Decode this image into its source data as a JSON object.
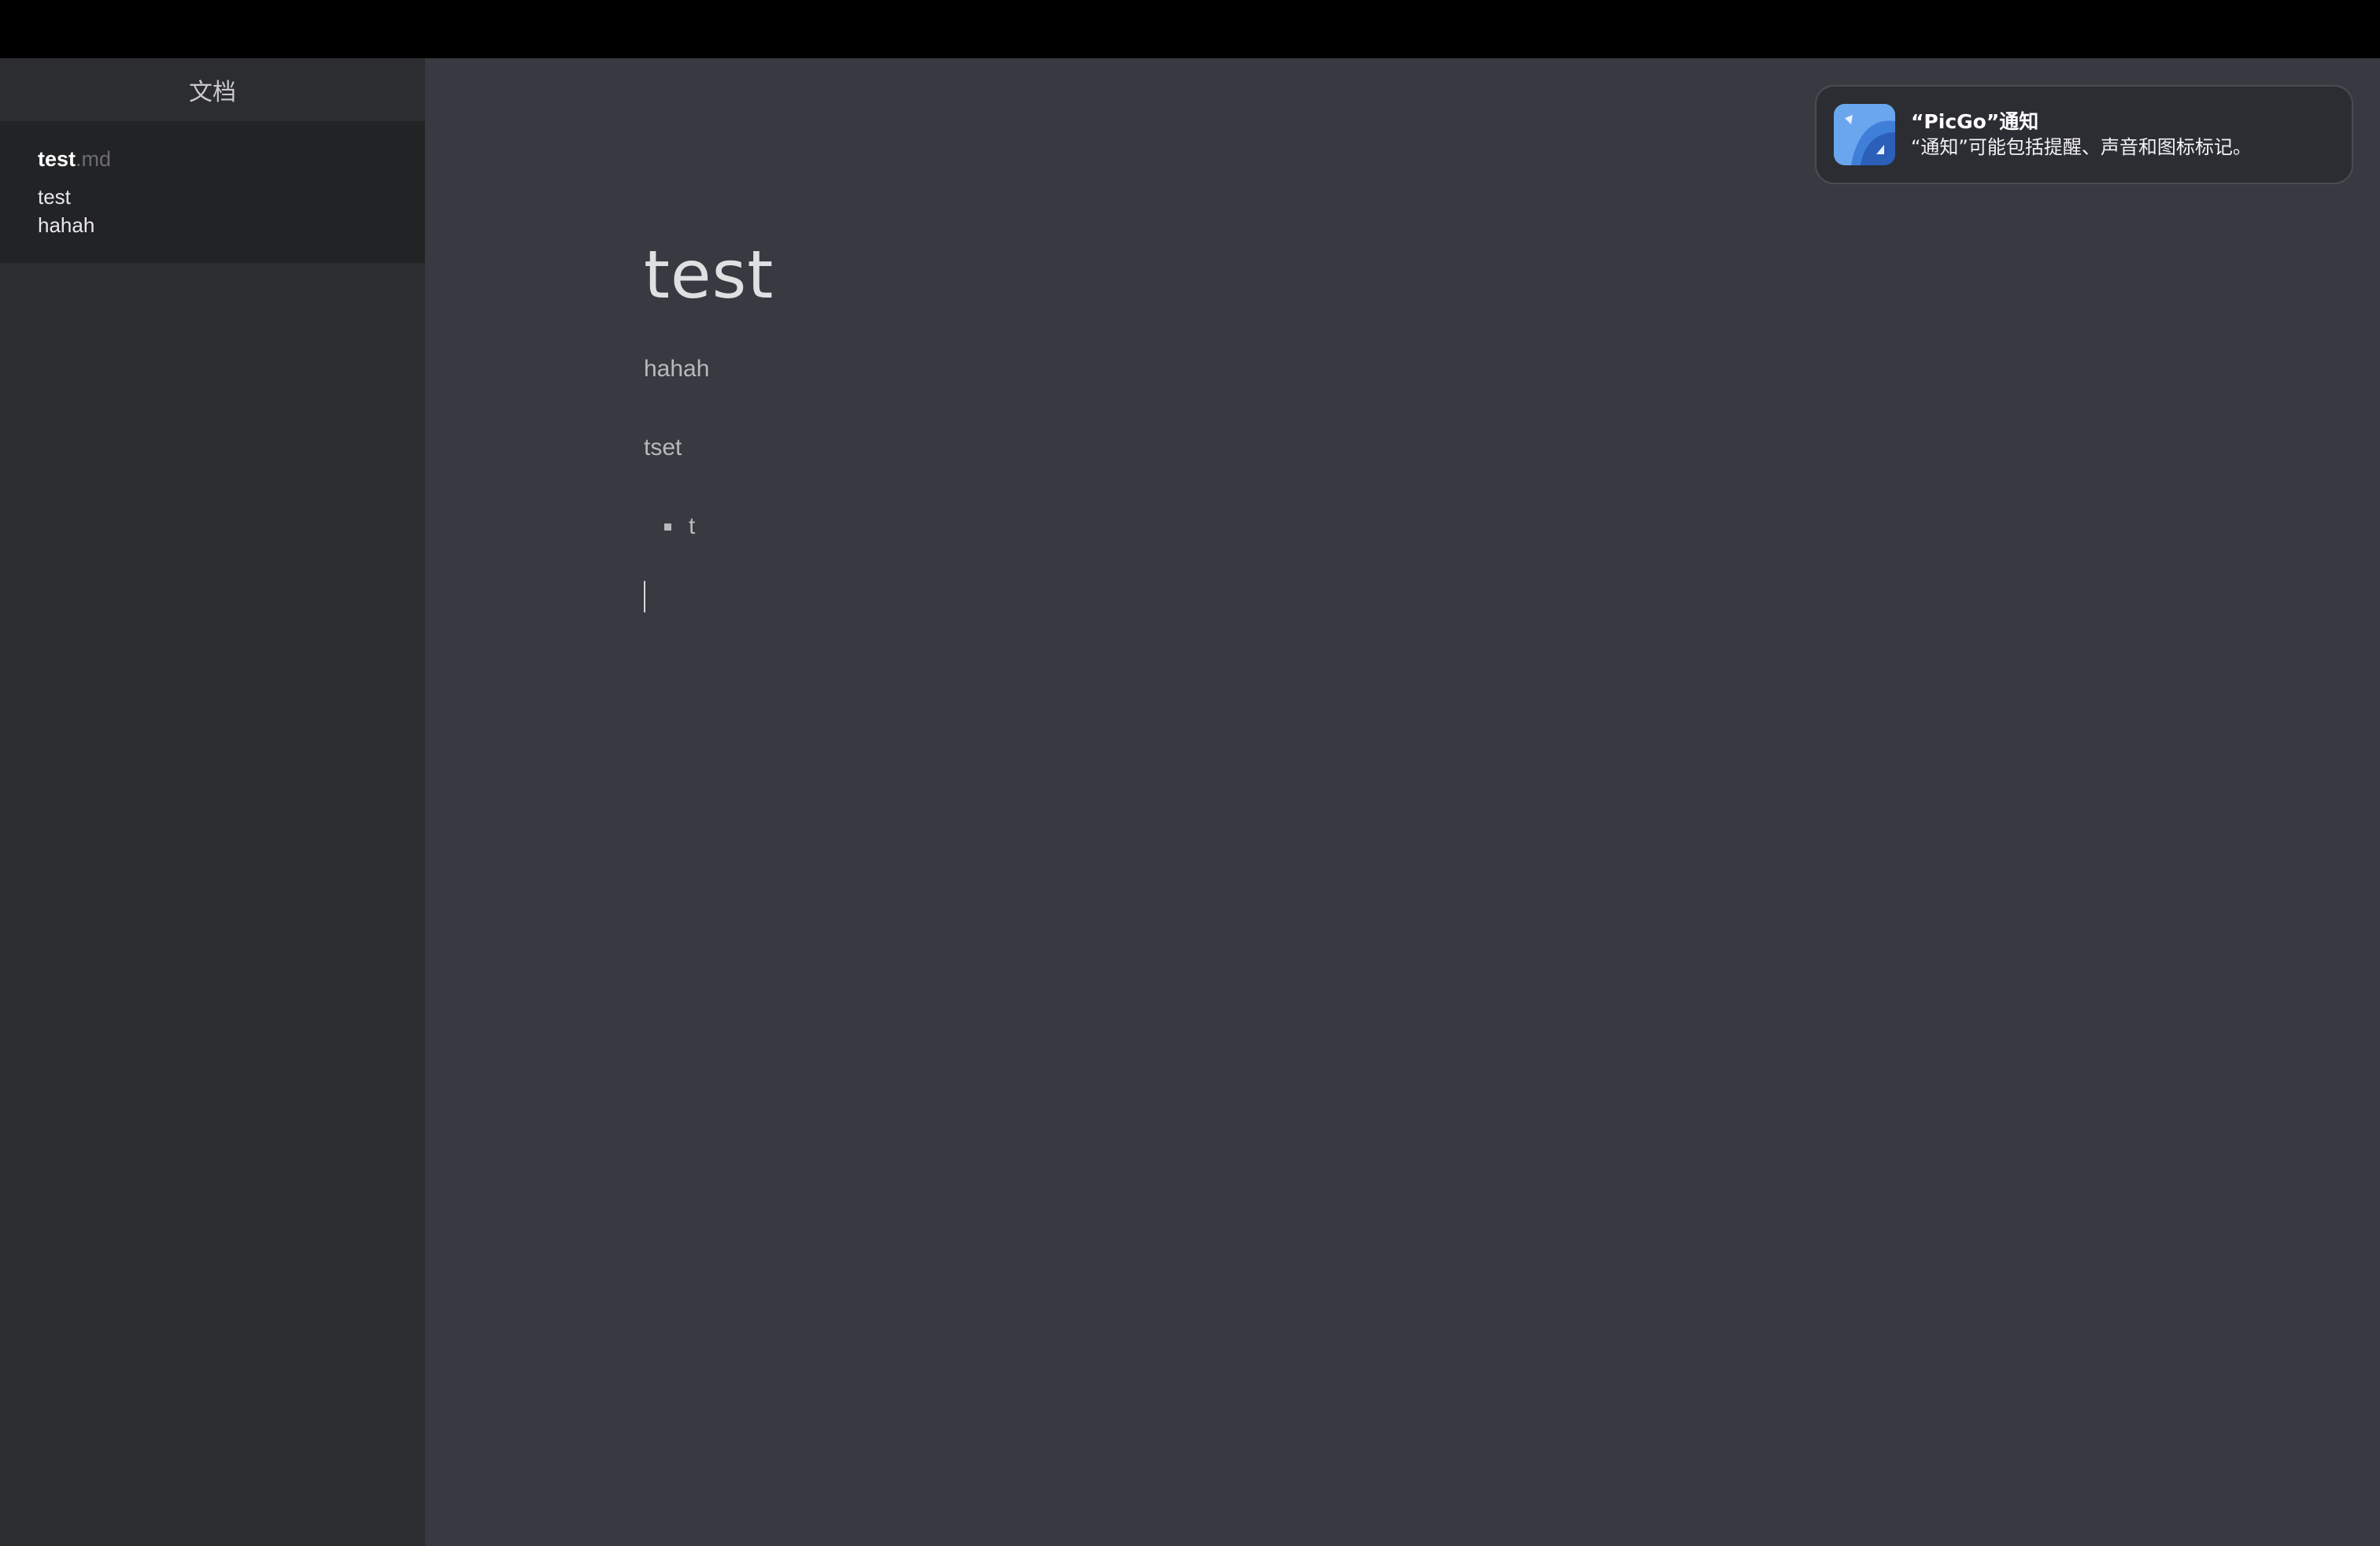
{
  "sidebar": {
    "header": "文档",
    "files": [
      {
        "name": "test",
        "ext": ".md",
        "preview": [
          "test",
          "hahah"
        ]
      }
    ]
  },
  "editor": {
    "heading": "test",
    "paragraphs": [
      "hahah",
      "tset"
    ],
    "list_items": [
      "t"
    ]
  },
  "notification": {
    "title": "“PicGo”通知",
    "body": "“通知”可能包括提醒、声音和图标标记。",
    "icon": "picgo-app-icon"
  },
  "colors": {
    "sidebar_bg": "#2c2d31",
    "selected_item_bg": "#222325",
    "editor_bg": "#373a40",
    "notification_bg": "#2b2d32",
    "icon_blue": "#3f7fd9"
  }
}
